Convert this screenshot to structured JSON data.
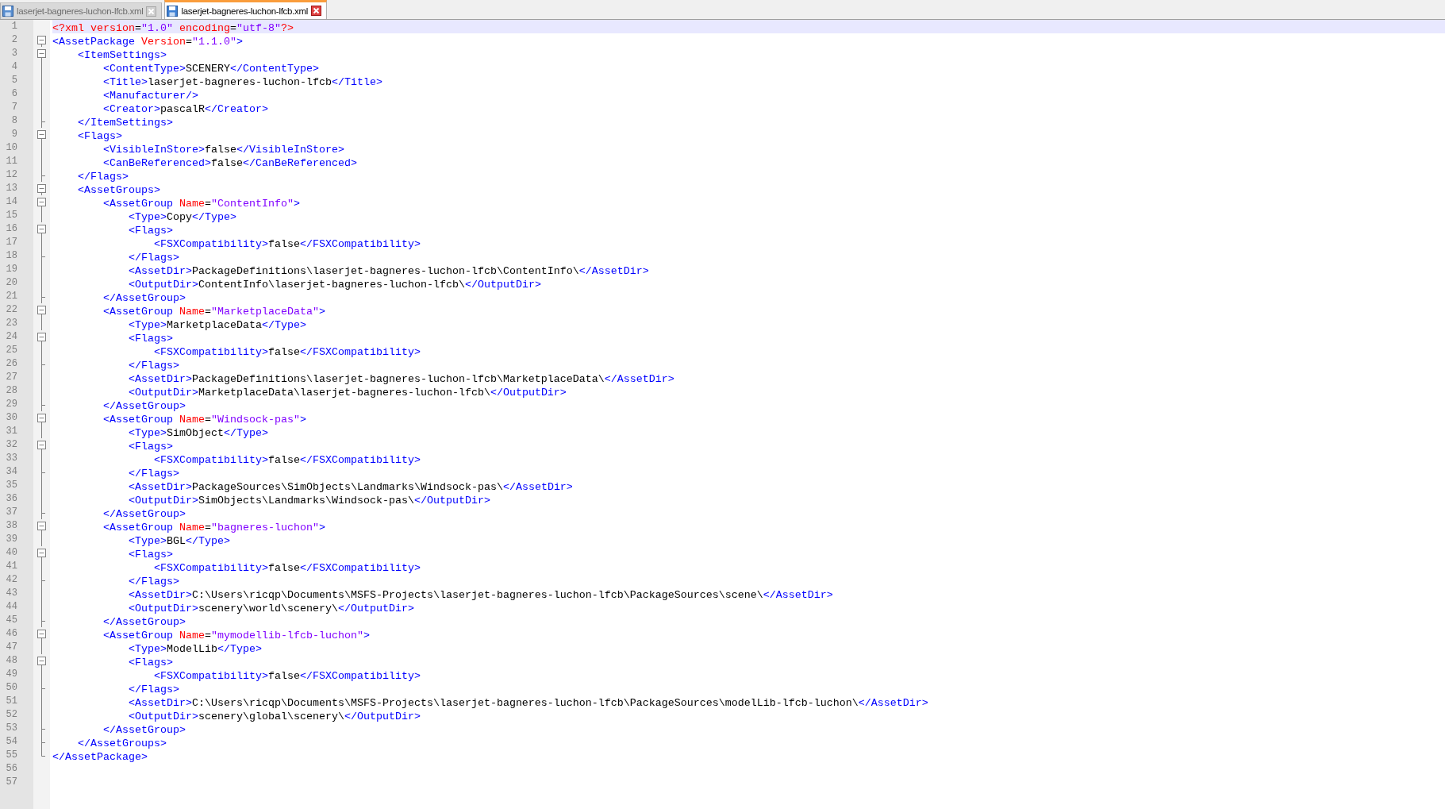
{
  "tabs": [
    {
      "label": "laserjet-bagneres-luchon-lfcb.xml",
      "selected": false
    },
    {
      "label": "laserjet-bagneres-luchon-lfcb.xml",
      "selected": true
    }
  ],
  "editor": {
    "lines": [
      {
        "number": "1",
        "fold_start": false,
        "fold_end": false,
        "current": true,
        "tokens": [
          {
            "kind": "decl",
            "text": "<?xml version"
          },
          {
            "kind": "text",
            "text": "="
          },
          {
            "kind": "value",
            "text": "\"1.0\""
          },
          {
            "kind": "decl",
            "text": " encoding"
          },
          {
            "kind": "text",
            "text": "="
          },
          {
            "kind": "value",
            "text": "\"utf-8\""
          },
          {
            "kind": "decl",
            "text": "?>"
          }
        ]
      },
      {
        "number": "2",
        "fold_start": true,
        "fold_end": false,
        "current": false,
        "tokens": [
          {
            "kind": "tag",
            "text": "<AssetPackage"
          },
          {
            "kind": "attr",
            "text": " Version"
          },
          {
            "kind": "text",
            "text": "="
          },
          {
            "kind": "value",
            "text": "\"1.1.0\""
          },
          {
            "kind": "tag",
            "text": ">"
          }
        ]
      },
      {
        "number": "3",
        "fold_start": true,
        "fold_end": false,
        "current": false,
        "tokens": [
          {
            "kind": "tag",
            "text": "    <ItemSettings>"
          }
        ]
      },
      {
        "number": "4",
        "fold_start": false,
        "fold_end": false,
        "current": false,
        "tokens": [
          {
            "kind": "tag",
            "text": "        <ContentType>"
          },
          {
            "kind": "text",
            "text": "SCENERY"
          },
          {
            "kind": "tag",
            "text": "</ContentType>"
          }
        ]
      },
      {
        "number": "5",
        "fold_start": false,
        "fold_end": false,
        "current": false,
        "tokens": [
          {
            "kind": "tag",
            "text": "        <Title>"
          },
          {
            "kind": "text",
            "text": "laserjet-bagneres-luchon-lfcb"
          },
          {
            "kind": "tag",
            "text": "</Title>"
          }
        ]
      },
      {
        "number": "6",
        "fold_start": false,
        "fold_end": false,
        "current": false,
        "tokens": [
          {
            "kind": "tag",
            "text": "        <Manufacturer/>"
          }
        ]
      },
      {
        "number": "7",
        "fold_start": false,
        "fold_end": false,
        "current": false,
        "tokens": [
          {
            "kind": "tag",
            "text": "        <Creator>"
          },
          {
            "kind": "text",
            "text": "pascalR"
          },
          {
            "kind": "tag",
            "text": "</Creator>"
          }
        ]
      },
      {
        "number": "8",
        "fold_start": false,
        "fold_end": true,
        "current": false,
        "tokens": [
          {
            "kind": "tag",
            "text": "    </ItemSettings>"
          }
        ]
      },
      {
        "number": "9",
        "fold_start": true,
        "fold_end": false,
        "current": false,
        "tokens": [
          {
            "kind": "tag",
            "text": "    <Flags>"
          }
        ]
      },
      {
        "number": "10",
        "fold_start": false,
        "fold_end": false,
        "current": false,
        "tokens": [
          {
            "kind": "tag",
            "text": "        <VisibleInStore>"
          },
          {
            "kind": "text",
            "text": "false"
          },
          {
            "kind": "tag",
            "text": "</VisibleInStore>"
          }
        ]
      },
      {
        "number": "11",
        "fold_start": false,
        "fold_end": false,
        "current": false,
        "tokens": [
          {
            "kind": "tag",
            "text": "        <CanBeReferenced>"
          },
          {
            "kind": "text",
            "text": "false"
          },
          {
            "kind": "tag",
            "text": "</CanBeReferenced>"
          }
        ]
      },
      {
        "number": "12",
        "fold_start": false,
        "fold_end": true,
        "current": false,
        "tokens": [
          {
            "kind": "tag",
            "text": "    </Flags>"
          }
        ]
      },
      {
        "number": "13",
        "fold_start": true,
        "fold_end": false,
        "current": false,
        "tokens": [
          {
            "kind": "tag",
            "text": "    <AssetGroups>"
          }
        ]
      },
      {
        "number": "14",
        "fold_start": true,
        "fold_end": false,
        "current": false,
        "tokens": [
          {
            "kind": "tag",
            "text": "        <AssetGroup"
          },
          {
            "kind": "attr",
            "text": " Name"
          },
          {
            "kind": "text",
            "text": "="
          },
          {
            "kind": "value",
            "text": "\"ContentInfo\""
          },
          {
            "kind": "tag",
            "text": ">"
          }
        ]
      },
      {
        "number": "15",
        "fold_start": false,
        "fold_end": false,
        "current": false,
        "tokens": [
          {
            "kind": "tag",
            "text": "            <Type>"
          },
          {
            "kind": "text",
            "text": "Copy"
          },
          {
            "kind": "tag",
            "text": "</Type>"
          }
        ]
      },
      {
        "number": "16",
        "fold_start": true,
        "fold_end": false,
        "current": false,
        "tokens": [
          {
            "kind": "tag",
            "text": "            <Flags>"
          }
        ]
      },
      {
        "number": "17",
        "fold_start": false,
        "fold_end": false,
        "current": false,
        "tokens": [
          {
            "kind": "tag",
            "text": "                <FSXCompatibility>"
          },
          {
            "kind": "text",
            "text": "false"
          },
          {
            "kind": "tag",
            "text": "</FSXCompatibility>"
          }
        ]
      },
      {
        "number": "18",
        "fold_start": false,
        "fold_end": true,
        "current": false,
        "tokens": [
          {
            "kind": "tag",
            "text": "            </Flags>"
          }
        ]
      },
      {
        "number": "19",
        "fold_start": false,
        "fold_end": false,
        "current": false,
        "tokens": [
          {
            "kind": "tag",
            "text": "            <AssetDir>"
          },
          {
            "kind": "text",
            "text": "PackageDefinitions\\laserjet-bagneres-luchon-lfcb\\ContentInfo\\"
          },
          {
            "kind": "tag",
            "text": "</AssetDir>"
          }
        ]
      },
      {
        "number": "20",
        "fold_start": false,
        "fold_end": false,
        "current": false,
        "tokens": [
          {
            "kind": "tag",
            "text": "            <OutputDir>"
          },
          {
            "kind": "text",
            "text": "ContentInfo\\laserjet-bagneres-luchon-lfcb\\"
          },
          {
            "kind": "tag",
            "text": "</OutputDir>"
          }
        ]
      },
      {
        "number": "21",
        "fold_start": false,
        "fold_end": true,
        "current": false,
        "tokens": [
          {
            "kind": "tag",
            "text": "        </AssetGroup>"
          }
        ]
      },
      {
        "number": "22",
        "fold_start": true,
        "fold_end": false,
        "current": false,
        "tokens": [
          {
            "kind": "tag",
            "text": "        <AssetGroup"
          },
          {
            "kind": "attr",
            "text": " Name"
          },
          {
            "kind": "text",
            "text": "="
          },
          {
            "kind": "value",
            "text": "\"MarketplaceData\""
          },
          {
            "kind": "tag",
            "text": ">"
          }
        ]
      },
      {
        "number": "23",
        "fold_start": false,
        "fold_end": false,
        "current": false,
        "tokens": [
          {
            "kind": "tag",
            "text": "            <Type>"
          },
          {
            "kind": "text",
            "text": "MarketplaceData"
          },
          {
            "kind": "tag",
            "text": "</Type>"
          }
        ]
      },
      {
        "number": "24",
        "fold_start": true,
        "fold_end": false,
        "current": false,
        "tokens": [
          {
            "kind": "tag",
            "text": "            <Flags>"
          }
        ]
      },
      {
        "number": "25",
        "fold_start": false,
        "fold_end": false,
        "current": false,
        "tokens": [
          {
            "kind": "tag",
            "text": "                <FSXCompatibility>"
          },
          {
            "kind": "text",
            "text": "false"
          },
          {
            "kind": "tag",
            "text": "</FSXCompatibility>"
          }
        ]
      },
      {
        "number": "26",
        "fold_start": false,
        "fold_end": true,
        "current": false,
        "tokens": [
          {
            "kind": "tag",
            "text": "            </Flags>"
          }
        ]
      },
      {
        "number": "27",
        "fold_start": false,
        "fold_end": false,
        "current": false,
        "tokens": [
          {
            "kind": "tag",
            "text": "            <AssetDir>"
          },
          {
            "kind": "text",
            "text": "PackageDefinitions\\laserjet-bagneres-luchon-lfcb\\MarketplaceData\\"
          },
          {
            "kind": "tag",
            "text": "</AssetDir>"
          }
        ]
      },
      {
        "number": "28",
        "fold_start": false,
        "fold_end": false,
        "current": false,
        "tokens": [
          {
            "kind": "tag",
            "text": "            <OutputDir>"
          },
          {
            "kind": "text",
            "text": "MarketplaceData\\laserjet-bagneres-luchon-lfcb\\"
          },
          {
            "kind": "tag",
            "text": "</OutputDir>"
          }
        ]
      },
      {
        "number": "29",
        "fold_start": false,
        "fold_end": true,
        "current": false,
        "tokens": [
          {
            "kind": "tag",
            "text": "        </AssetGroup>"
          }
        ]
      },
      {
        "number": "30",
        "fold_start": true,
        "fold_end": false,
        "current": false,
        "tokens": [
          {
            "kind": "tag",
            "text": "        <AssetGroup"
          },
          {
            "kind": "attr",
            "text": " Name"
          },
          {
            "kind": "text",
            "text": "="
          },
          {
            "kind": "value",
            "text": "\"Windsock-pas\""
          },
          {
            "kind": "tag",
            "text": ">"
          }
        ]
      },
      {
        "number": "31",
        "fold_start": false,
        "fold_end": false,
        "current": false,
        "tokens": [
          {
            "kind": "tag",
            "text": "            <Type>"
          },
          {
            "kind": "text",
            "text": "SimObject"
          },
          {
            "kind": "tag",
            "text": "</Type>"
          }
        ]
      },
      {
        "number": "32",
        "fold_start": true,
        "fold_end": false,
        "current": false,
        "tokens": [
          {
            "kind": "tag",
            "text": "            <Flags>"
          }
        ]
      },
      {
        "number": "33",
        "fold_start": false,
        "fold_end": false,
        "current": false,
        "tokens": [
          {
            "kind": "tag",
            "text": "                <FSXCompatibility>"
          },
          {
            "kind": "text",
            "text": "false"
          },
          {
            "kind": "tag",
            "text": "</FSXCompatibility>"
          }
        ]
      },
      {
        "number": "34",
        "fold_start": false,
        "fold_end": true,
        "current": false,
        "tokens": [
          {
            "kind": "tag",
            "text": "            </Flags>"
          }
        ]
      },
      {
        "number": "35",
        "fold_start": false,
        "fold_end": false,
        "current": false,
        "tokens": [
          {
            "kind": "tag",
            "text": "            <AssetDir>"
          },
          {
            "kind": "text",
            "text": "PackageSources\\SimObjects\\Landmarks\\Windsock-pas\\"
          },
          {
            "kind": "tag",
            "text": "</AssetDir>"
          }
        ]
      },
      {
        "number": "36",
        "fold_start": false,
        "fold_end": false,
        "current": false,
        "tokens": [
          {
            "kind": "tag",
            "text": "            <OutputDir>"
          },
          {
            "kind": "text",
            "text": "SimObjects\\Landmarks\\Windsock-pas\\"
          },
          {
            "kind": "tag",
            "text": "</OutputDir>"
          }
        ]
      },
      {
        "number": "37",
        "fold_start": false,
        "fold_end": true,
        "current": false,
        "tokens": [
          {
            "kind": "tag",
            "text": "        </AssetGroup>"
          }
        ]
      },
      {
        "number": "38",
        "fold_start": true,
        "fold_end": false,
        "current": false,
        "tokens": [
          {
            "kind": "tag",
            "text": "        <AssetGroup"
          },
          {
            "kind": "attr",
            "text": " Name"
          },
          {
            "kind": "text",
            "text": "="
          },
          {
            "kind": "value",
            "text": "\"bagneres-luchon\""
          },
          {
            "kind": "tag",
            "text": ">"
          }
        ]
      },
      {
        "number": "39",
        "fold_start": false,
        "fold_end": false,
        "current": false,
        "tokens": [
          {
            "kind": "tag",
            "text": "            <Type>"
          },
          {
            "kind": "text",
            "text": "BGL"
          },
          {
            "kind": "tag",
            "text": "</Type>"
          }
        ]
      },
      {
        "number": "40",
        "fold_start": true,
        "fold_end": false,
        "current": false,
        "tokens": [
          {
            "kind": "tag",
            "text": "            <Flags>"
          }
        ]
      },
      {
        "number": "41",
        "fold_start": false,
        "fold_end": false,
        "current": false,
        "tokens": [
          {
            "kind": "tag",
            "text": "                <FSXCompatibility>"
          },
          {
            "kind": "text",
            "text": "false"
          },
          {
            "kind": "tag",
            "text": "</FSXCompatibility>"
          }
        ]
      },
      {
        "number": "42",
        "fold_start": false,
        "fold_end": true,
        "current": false,
        "tokens": [
          {
            "kind": "tag",
            "text": "            </Flags>"
          }
        ]
      },
      {
        "number": "43",
        "fold_start": false,
        "fold_end": false,
        "current": false,
        "tokens": [
          {
            "kind": "tag",
            "text": "            <AssetDir>"
          },
          {
            "kind": "text",
            "text": "C:\\Users\\ricqp\\Documents\\MSFS-Projects\\laserjet-bagneres-luchon-lfcb\\PackageSources\\scene\\"
          },
          {
            "kind": "tag",
            "text": "</AssetDir>"
          }
        ]
      },
      {
        "number": "44",
        "fold_start": false,
        "fold_end": false,
        "current": false,
        "tokens": [
          {
            "kind": "tag",
            "text": "            <OutputDir>"
          },
          {
            "kind": "text",
            "text": "scenery\\world\\scenery\\"
          },
          {
            "kind": "tag",
            "text": "</OutputDir>"
          }
        ]
      },
      {
        "number": "45",
        "fold_start": false,
        "fold_end": true,
        "current": false,
        "tokens": [
          {
            "kind": "tag",
            "text": "        </AssetGroup>"
          }
        ]
      },
      {
        "number": "46",
        "fold_start": true,
        "fold_end": false,
        "current": false,
        "tokens": [
          {
            "kind": "tag",
            "text": "        <AssetGroup"
          },
          {
            "kind": "attr",
            "text": " Name"
          },
          {
            "kind": "text",
            "text": "="
          },
          {
            "kind": "value",
            "text": "\"mymodellib-lfcb-luchon\""
          },
          {
            "kind": "tag",
            "text": ">"
          }
        ]
      },
      {
        "number": "47",
        "fold_start": false,
        "fold_end": false,
        "current": false,
        "tokens": [
          {
            "kind": "tag",
            "text": "            <Type>"
          },
          {
            "kind": "text",
            "text": "ModelLib"
          },
          {
            "kind": "tag",
            "text": "</Type>"
          }
        ]
      },
      {
        "number": "48",
        "fold_start": true,
        "fold_end": false,
        "current": false,
        "tokens": [
          {
            "kind": "tag",
            "text": "            <Flags>"
          }
        ]
      },
      {
        "number": "49",
        "fold_start": false,
        "fold_end": false,
        "current": false,
        "tokens": [
          {
            "kind": "tag",
            "text": "                <FSXCompatibility>"
          },
          {
            "kind": "text",
            "text": "false"
          },
          {
            "kind": "tag",
            "text": "</FSXCompatibility>"
          }
        ]
      },
      {
        "number": "50",
        "fold_start": false,
        "fold_end": true,
        "current": false,
        "tokens": [
          {
            "kind": "tag",
            "text": "            </Flags>"
          }
        ]
      },
      {
        "number": "51",
        "fold_start": false,
        "fold_end": false,
        "current": false,
        "tokens": [
          {
            "kind": "tag",
            "text": "            <AssetDir>"
          },
          {
            "kind": "text",
            "text": "C:\\Users\\ricqp\\Documents\\MSFS-Projects\\laserjet-bagneres-luchon-lfcb\\PackageSources\\modelLib-lfcb-luchon\\"
          },
          {
            "kind": "tag",
            "text": "</AssetDir>"
          }
        ]
      },
      {
        "number": "52",
        "fold_start": false,
        "fold_end": false,
        "current": false,
        "tokens": [
          {
            "kind": "tag",
            "text": "            <OutputDir>"
          },
          {
            "kind": "text",
            "text": "scenery\\global\\scenery\\"
          },
          {
            "kind": "tag",
            "text": "</OutputDir>"
          }
        ]
      },
      {
        "number": "53",
        "fold_start": false,
        "fold_end": true,
        "current": false,
        "tokens": [
          {
            "kind": "tag",
            "text": "        </AssetGroup>"
          }
        ]
      },
      {
        "number": "54",
        "fold_start": false,
        "fold_end": true,
        "current": false,
        "tokens": [
          {
            "kind": "tag",
            "text": "    </AssetGroups>"
          }
        ]
      },
      {
        "number": "55",
        "fold_start": false,
        "fold_end": true,
        "current": false,
        "tokens": [
          {
            "kind": "tag",
            "text": "</AssetPackage>"
          }
        ]
      },
      {
        "number": "56",
        "fold_start": false,
        "fold_end": false,
        "current": false
      },
      {
        "number": "57",
        "fold_start": false,
        "fold_end": false,
        "current": false
      }
    ]
  }
}
